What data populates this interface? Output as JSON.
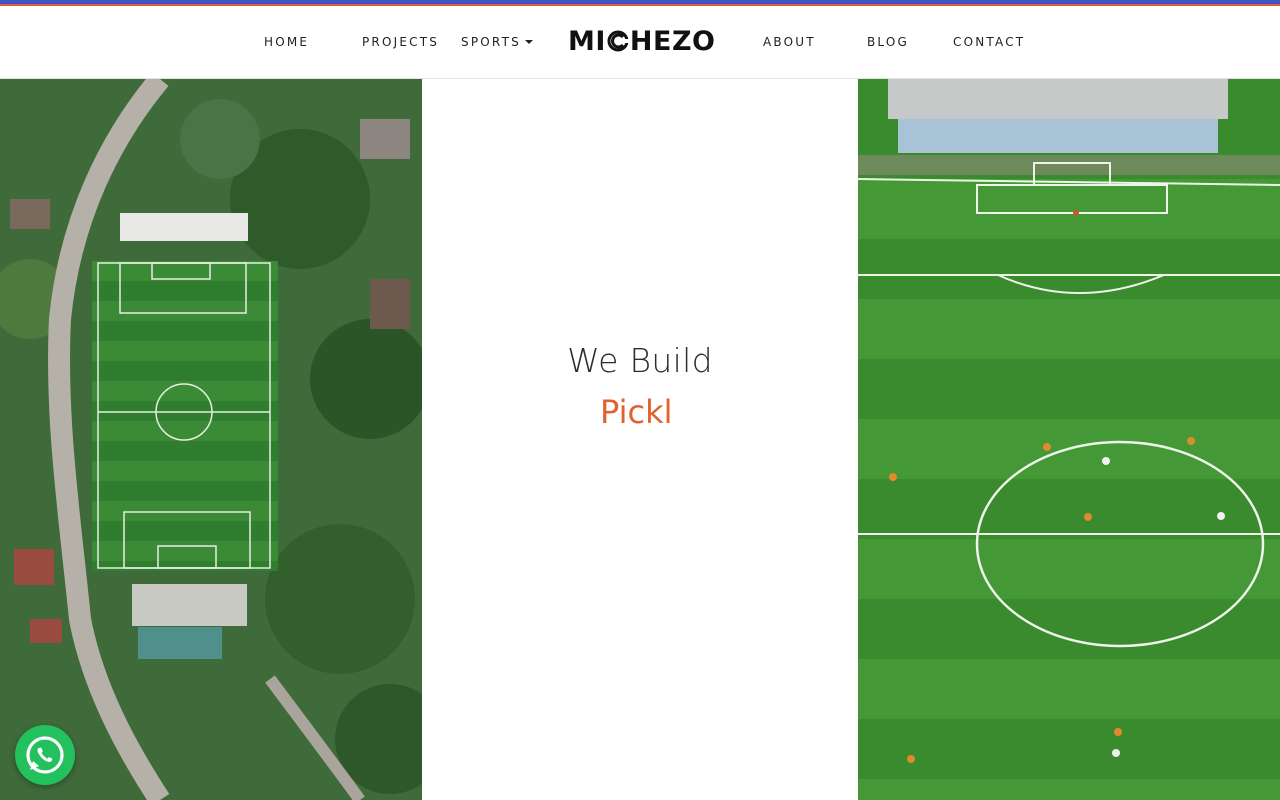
{
  "nav": {
    "left": [
      {
        "label": "HOME"
      },
      {
        "label": "PROJECTS"
      },
      {
        "label": "SPORTS"
      }
    ],
    "right": [
      {
        "label": "ABOUT"
      },
      {
        "label": "BLOG"
      },
      {
        "label": "CONTACT"
      }
    ]
  },
  "logo": {
    "prefix": "MI",
    "suffix": "HEZO"
  },
  "hero": {
    "line1": "We Build",
    "line2": "Pickl"
  },
  "colors": {
    "accent": "#e0622f",
    "stripe_blue": "#3a56c5",
    "stripe_red": "#e05a3a",
    "whatsapp": "#22c15e"
  },
  "icons": {
    "whatsapp": "whatsapp-icon",
    "dropdown": "caret-down-icon"
  }
}
